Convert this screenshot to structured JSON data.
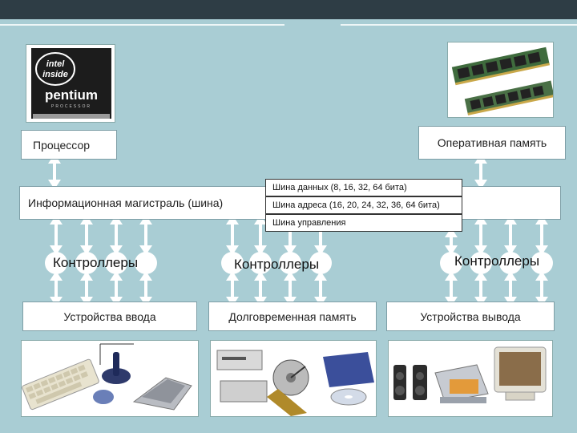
{
  "diagram": {
    "processor_label": "Процессор",
    "ram_label": "Оперативная память",
    "bus_label": "Информационная магистраль (шина)",
    "bus_data_label": "Шина данных (8, 16, 32, 64 бита)",
    "bus_address_label": "Шина адреса (16, 20, 24, 32, 36, 64 бита)",
    "bus_control_label": "Шина управления",
    "controllers_left": "Контроллеры",
    "controllers_middle": "Контроллеры",
    "controllers_right": "Контроллеры",
    "input_devices_label": "Устройства ввода",
    "storage_label": "Долговременная память",
    "output_devices_label": "Устройства вывода",
    "cpu_logo": {
      "line1": "intel",
      "line2": "inside",
      "line3": "pentium",
      "line4": "PROCESSOR"
    }
  },
  "colors": {
    "background": "#a9cdd4",
    "topbar": "#2e3d45",
    "box_fill": "#ffffff"
  }
}
